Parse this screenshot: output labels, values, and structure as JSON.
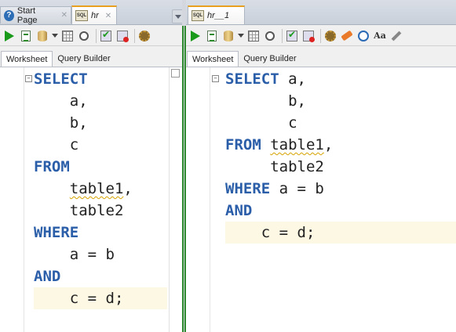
{
  "left": {
    "tabs": [
      {
        "label": "Start Page",
        "icon": "help-icon"
      },
      {
        "label": "hr",
        "icon": "sql-icon"
      }
    ],
    "subtabs": [
      "Worksheet",
      "Query Builder"
    ],
    "code_lines": [
      [
        {
          "t": "SELECT",
          "k": true
        }
      ],
      [
        {
          "t": "    a,",
          "k": false
        }
      ],
      [
        {
          "t": "    b,",
          "k": false
        }
      ],
      [
        {
          "t": "    c",
          "k": false
        }
      ],
      [
        {
          "t": "FROM",
          "k": true
        }
      ],
      [
        {
          "t": "    ",
          "k": false
        },
        {
          "t": "table1",
          "k": false,
          "sq": true
        },
        {
          "t": ",",
          "k": false
        }
      ],
      [
        {
          "t": "    table2",
          "k": false
        }
      ],
      [
        {
          "t": "WHERE",
          "k": true
        }
      ],
      [
        {
          "t": "    a = b",
          "k": false
        }
      ],
      [
        {
          "t": "AND",
          "k": true
        }
      ],
      [
        {
          "t": "    c = d;",
          "k": false,
          "hl": true
        }
      ]
    ]
  },
  "right": {
    "tabs": [
      {
        "label": "hr__1",
        "icon": "sql-icon"
      }
    ],
    "subtabs": [
      "Worksheet",
      "Query Builder"
    ],
    "code_lines": [
      [
        {
          "t": "SELECT",
          "k": true
        },
        {
          "t": " a,",
          "k": false
        }
      ],
      [
        {
          "t": "       b,",
          "k": false
        }
      ],
      [
        {
          "t": "       c",
          "k": false
        }
      ],
      [
        {
          "t": "FROM",
          "k": true
        },
        {
          "t": " ",
          "k": false
        },
        {
          "t": "table1",
          "k": false,
          "sq": true
        },
        {
          "t": ",",
          "k": false
        }
      ],
      [
        {
          "t": "     table2",
          "k": false
        }
      ],
      [
        {
          "t": "WHERE",
          "k": true
        },
        {
          "t": " a = b",
          "k": false
        }
      ],
      [
        {
          "t": "AND",
          "k": true
        }
      ],
      [
        {
          "t": "    c = d;",
          "k": false,
          "hl": true
        }
      ]
    ]
  },
  "colors": {
    "keyword": "#2b5ea8",
    "highlight": "#fdf8e3",
    "run": "#1a9a1a"
  }
}
